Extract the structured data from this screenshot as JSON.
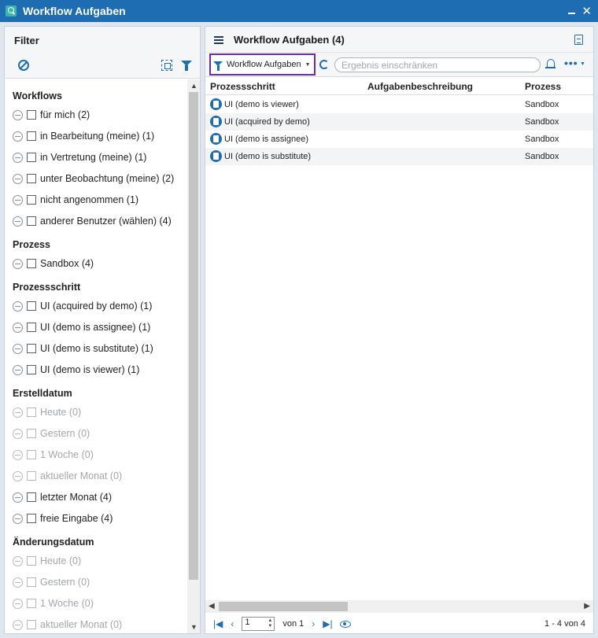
{
  "window": {
    "title": "Workflow Aufgaben"
  },
  "filter": {
    "title": "Filter",
    "sections": [
      {
        "heading": "Workflows",
        "items": [
          {
            "label": "für mich (2)",
            "enabled": true
          },
          {
            "label": "in Bearbeitung (meine) (1)",
            "enabled": true
          },
          {
            "label": "in Vertretung (meine) (1)",
            "enabled": true
          },
          {
            "label": "unter Beobachtung (meine) (2)",
            "enabled": true
          },
          {
            "label": "nicht angenommen (1)",
            "enabled": true
          },
          {
            "label": "anderer Benutzer (wählen) (4)",
            "enabled": true
          }
        ]
      },
      {
        "heading": "Prozess",
        "items": [
          {
            "label": "Sandbox (4)",
            "enabled": true
          }
        ]
      },
      {
        "heading": "Prozessschritt",
        "items": [
          {
            "label": "UI (acquired by demo) (1)",
            "enabled": true
          },
          {
            "label": "UI (demo is assignee) (1)",
            "enabled": true
          },
          {
            "label": "UI (demo is substitute) (1)",
            "enabled": true
          },
          {
            "label": "UI (demo is viewer) (1)",
            "enabled": true
          }
        ]
      },
      {
        "heading": "Erstelldatum",
        "items": [
          {
            "label": "Heute (0)",
            "enabled": false
          },
          {
            "label": "Gestern (0)",
            "enabled": false
          },
          {
            "label": "1 Woche (0)",
            "enabled": false
          },
          {
            "label": "aktueller Monat (0)",
            "enabled": false
          },
          {
            "label": "letzter Monat (4)",
            "enabled": true
          },
          {
            "label": "freie Eingabe (4)",
            "enabled": true
          }
        ]
      },
      {
        "heading": "Änderungsdatum",
        "items": [
          {
            "label": "Heute (0)",
            "enabled": false
          },
          {
            "label": "Gestern (0)",
            "enabled": false
          },
          {
            "label": "1 Woche (0)",
            "enabled": false
          },
          {
            "label": "aktueller Monat (0)",
            "enabled": false
          }
        ]
      }
    ]
  },
  "main": {
    "title": "Workflow Aufgaben (4)",
    "toolbar": {
      "workflow_select": "Workflow Aufgaben",
      "search_placeholder": "Ergebnis einschränken"
    },
    "columns": [
      "Prozessschritt",
      "Aufgabenbeschreibung",
      "Prozess"
    ],
    "rows": [
      {
        "step": "UI (demo is viewer)",
        "description": "",
        "process": "Sandbox"
      },
      {
        "step": "UI (acquired by demo)",
        "description": "",
        "process": "Sandbox"
      },
      {
        "step": "UI (demo is assignee)",
        "description": "",
        "process": "Sandbox"
      },
      {
        "step": "UI (demo is substitute)",
        "description": "",
        "process": "Sandbox"
      }
    ],
    "pager": {
      "page": "1",
      "of_label": "von 1",
      "range": "1 - 4 von 4"
    }
  },
  "colors": {
    "accent": "#1e6db2",
    "title_bar": "#1e6db2",
    "select_border": "#6b2c9e"
  }
}
